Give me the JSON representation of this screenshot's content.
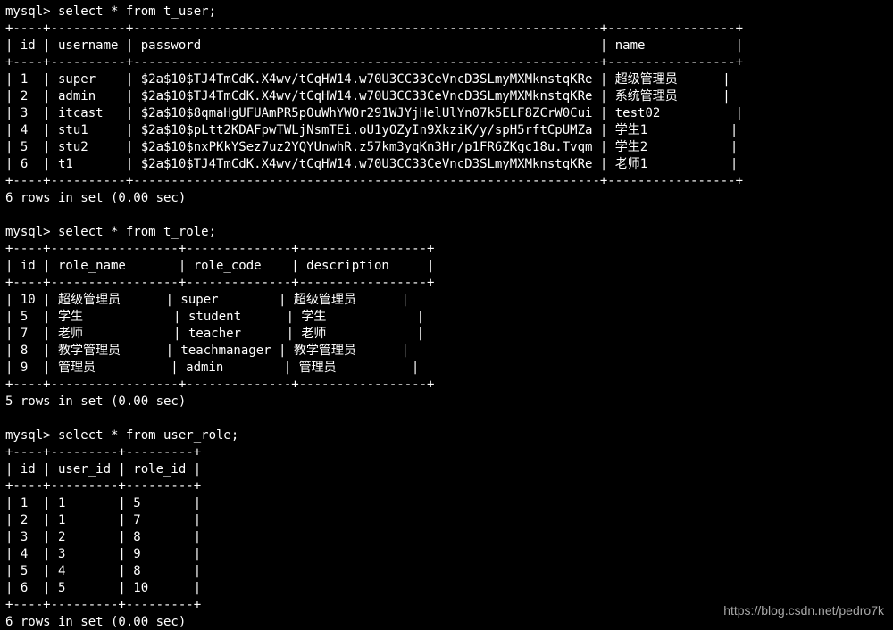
{
  "prompt": "mysql>",
  "queries": {
    "q1": "select * from t_user;",
    "q2": "select * from t_role;",
    "q3": "select * from user_role;"
  },
  "t_user": {
    "headers": [
      "id",
      "username",
      "password",
      "name"
    ],
    "border": "+----+----------+--------------------------------------------------------------+-----------------+",
    "rows": [
      {
        "id": "1",
        "username": "super",
        "password": "$2a$10$TJ4TmCdK.X4wv/tCqHW14.w70U3CC33CeVncD3SLmyMXMknstqKRe",
        "name": "超级管理员"
      },
      {
        "id": "2",
        "username": "admin",
        "password": "$2a$10$TJ4TmCdK.X4wv/tCqHW14.w70U3CC33CeVncD3SLmyMXMknstqKRe",
        "name": "系统管理员"
      },
      {
        "id": "3",
        "username": "itcast",
        "password": "$2a$10$8qmaHgUFUAmPR5pOuWhYWOr291WJYjHelUlYn07k5ELF8ZCrW0Cui",
        "name": "test02"
      },
      {
        "id": "4",
        "username": "stu1",
        "password": "$2a$10$pLtt2KDAFpwTWLjNsmTEi.oU1yOZyIn9XkziK/y/spH5rftCpUMZa",
        "name": "学生1"
      },
      {
        "id": "5",
        "username": "stu2",
        "password": "$2a$10$nxPKkYSez7uz2YQYUnwhR.z57km3yqKn3Hr/p1FR6ZKgc18u.Tvqm",
        "name": "学生2"
      },
      {
        "id": "6",
        "username": "t1",
        "password": "$2a$10$TJ4TmCdK.X4wv/tCqHW14.w70U3CC33CeVncD3SLmyMXMknstqKRe",
        "name": "老师1"
      }
    ],
    "footer": "6 rows in set (0.00 sec)"
  },
  "t_role": {
    "headers": [
      "id",
      "role_name",
      "role_code",
      "description"
    ],
    "border": "+----+-----------------+--------------+-----------------+",
    "rows": [
      {
        "id": "10",
        "role_name": "超级管理员",
        "role_code": "super",
        "description": "超级管理员"
      },
      {
        "id": "5",
        "role_name": "学生",
        "role_code": "student",
        "description": "学生"
      },
      {
        "id": "7",
        "role_name": "老师",
        "role_code": "teacher",
        "description": "老师"
      },
      {
        "id": "8",
        "role_name": "教学管理员",
        "role_code": "teachmanager",
        "description": "教学管理员"
      },
      {
        "id": "9",
        "role_name": "管理员",
        "role_code": "admin",
        "description": "管理员"
      }
    ],
    "footer": "5 rows in set (0.00 sec)"
  },
  "user_role": {
    "headers": [
      "id",
      "user_id",
      "role_id"
    ],
    "border": "+----+---------+---------+",
    "rows": [
      {
        "id": "1",
        "user_id": "1",
        "role_id": "5"
      },
      {
        "id": "2",
        "user_id": "1",
        "role_id": "7"
      },
      {
        "id": "3",
        "user_id": "2",
        "role_id": "8"
      },
      {
        "id": "4",
        "user_id": "3",
        "role_id": "9"
      },
      {
        "id": "5",
        "user_id": "4",
        "role_id": "8"
      },
      {
        "id": "6",
        "user_id": "5",
        "role_id": "10"
      }
    ],
    "footer": "6 rows in set (0.00 sec)"
  },
  "watermark": "https://blog.csdn.net/pedro7k",
  "chart_data": {
    "type": "table",
    "tables": [
      {
        "name": "t_user",
        "columns": [
          "id",
          "username",
          "password",
          "name"
        ],
        "rows": [
          [
            1,
            "super",
            "$2a$10$TJ4TmCdK.X4wv/tCqHW14.w70U3CC33CeVncD3SLmyMXMknstqKRe",
            "超级管理员"
          ],
          [
            2,
            "admin",
            "$2a$10$TJ4TmCdK.X4wv/tCqHW14.w70U3CC33CeVncD3SLmyMXMknstqKRe",
            "系统管理员"
          ],
          [
            3,
            "itcast",
            "$2a$10$8qmaHgUFUAmPR5pOuWhYWOr291WJYjHelUlYn07k5ELF8ZCrW0Cui",
            "test02"
          ],
          [
            4,
            "stu1",
            "$2a$10$pLtt2KDAFpwTWLjNsmTEi.oU1yOZyIn9XkziK/y/spH5rftCpUMZa",
            "学生1"
          ],
          [
            5,
            "stu2",
            "$2a$10$nxPKkYSez7uz2YQYUnwhR.z57km3yqKn3Hr/p1FR6ZKgc18u.Tvqm",
            "学生2"
          ],
          [
            6,
            "t1",
            "$2a$10$TJ4TmCdK.X4wv/tCqHW14.w70U3CC33CeVncD3SLmyMXMknstqKRe",
            "老师1"
          ]
        ]
      },
      {
        "name": "t_role",
        "columns": [
          "id",
          "role_name",
          "role_code",
          "description"
        ],
        "rows": [
          [
            10,
            "超级管理员",
            "super",
            "超级管理员"
          ],
          [
            5,
            "学生",
            "student",
            "学生"
          ],
          [
            7,
            "老师",
            "teacher",
            "老师"
          ],
          [
            8,
            "教学管理员",
            "teachmanager",
            "教学管理员"
          ],
          [
            9,
            "管理员",
            "admin",
            "管理员"
          ]
        ]
      },
      {
        "name": "user_role",
        "columns": [
          "id",
          "user_id",
          "role_id"
        ],
        "rows": [
          [
            1,
            1,
            5
          ],
          [
            2,
            1,
            7
          ],
          [
            3,
            2,
            8
          ],
          [
            4,
            3,
            9
          ],
          [
            5,
            4,
            8
          ],
          [
            6,
            5,
            10
          ]
        ]
      }
    ]
  }
}
